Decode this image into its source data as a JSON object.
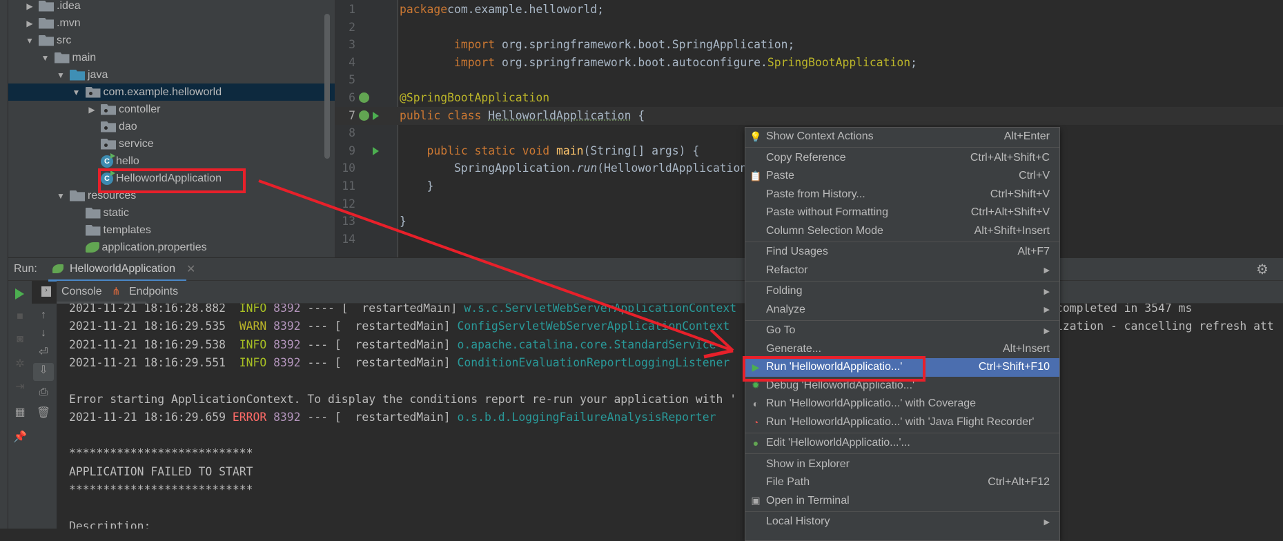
{
  "project_tree": [
    {
      "label": ".idea",
      "depth": 0,
      "arrow": "right",
      "icon": "folder"
    },
    {
      "label": ".mvn",
      "depth": 0,
      "arrow": "right",
      "icon": "folder"
    },
    {
      "label": "src",
      "depth": 0,
      "arrow": "down",
      "icon": "folder"
    },
    {
      "label": "main",
      "depth": 1,
      "arrow": "down",
      "icon": "folder"
    },
    {
      "label": "java",
      "depth": 2,
      "arrow": "down",
      "icon": "source-folder"
    },
    {
      "label": "com.example.helloworld",
      "depth": 3,
      "arrow": "down",
      "icon": "package",
      "selected": true
    },
    {
      "label": "contoller",
      "depth": 4,
      "arrow": "right",
      "icon": "package"
    },
    {
      "label": "dao",
      "depth": 4,
      "arrow": "",
      "icon": "package"
    },
    {
      "label": "service",
      "depth": 4,
      "arrow": "",
      "icon": "package"
    },
    {
      "label": "hello",
      "depth": 4,
      "arrow": "",
      "icon": "class"
    },
    {
      "label": "HelloworldApplication",
      "depth": 4,
      "arrow": "",
      "icon": "spring-boot-class",
      "highlighted": true
    },
    {
      "label": "resources",
      "depth": 2,
      "arrow": "down",
      "icon": "resources-folder"
    },
    {
      "label": "static",
      "depth": 3,
      "arrow": "",
      "icon": "folder"
    },
    {
      "label": "templates",
      "depth": 3,
      "arrow": "",
      "icon": "folder"
    },
    {
      "label": "application.properties",
      "depth": 3,
      "arrow": "",
      "icon": "spring-properties"
    }
  ],
  "editor": {
    "current_line": 7,
    "lines": [
      {
        "n": "1",
        "tokens": [
          [
            "kw",
            "package"
          ],
          [
            "",
            "com.example.helloworld;"
          ]
        ]
      },
      {
        "n": "2",
        "tokens": []
      },
      {
        "n": "3",
        "tokens": [
          [
            "",
            "        "
          ],
          [
            "kw",
            "import"
          ],
          [
            "",
            " org.springframework.boot.SpringApplication;"
          ]
        ]
      },
      {
        "n": "4",
        "tokens": [
          [
            "",
            "        "
          ],
          [
            "kw",
            "import"
          ],
          [
            "",
            " org.springframework.boot.autoconfigure."
          ],
          [
            "an",
            "SpringBootApplication"
          ],
          [
            "",
            ";"
          ]
        ]
      },
      {
        "n": "5",
        "tokens": []
      },
      {
        "n": "6",
        "tokens": [
          [
            "an",
            "@SpringBootApplication"
          ]
        ],
        "gutter": "spring"
      },
      {
        "n": "7",
        "tokens": [
          [
            "kw",
            "public class "
          ],
          [
            "ul",
            "HelloworldApplication"
          ],
          [
            "",
            " {"
          ]
        ],
        "gutter": "spring-run"
      },
      {
        "n": "8",
        "tokens": []
      },
      {
        "n": "9",
        "tokens": [
          [
            "",
            "    "
          ],
          [
            "kw",
            "public static void "
          ],
          [
            "fn",
            "main"
          ],
          [
            "",
            "(String[] args) {"
          ]
        ],
        "gutter": "run"
      },
      {
        "n": "10",
        "tokens": [
          [
            "",
            "        SpringApplication."
          ],
          [
            "it",
            "run"
          ],
          [
            "",
            "(HelloworldApplication"
          ]
        ]
      },
      {
        "n": "11",
        "tokens": [
          [
            "",
            "    }"
          ]
        ]
      },
      {
        "n": "12",
        "tokens": []
      },
      {
        "n": "13",
        "tokens": [
          [
            "",
            "}"
          ]
        ]
      },
      {
        "n": "14",
        "tokens": []
      }
    ]
  },
  "run_panel": {
    "label": "Run:",
    "tab": "HelloworldApplication",
    "subtabs": [
      "Console",
      "Endpoints"
    ],
    "console": [
      {
        "ts": "2021-11-21 18:16:28.882",
        "level": "INFO",
        "pid": "8392",
        "thread": "---- [  restartedMain]",
        "logger": "w.s.c.ServletWebServerApplicationContext",
        "tail": "completed in 3547 ms"
      },
      {
        "ts": "2021-11-21 18:16:29.535",
        "level": "WARN",
        "pid": "8392",
        "thread": "--- [  restartedMain]",
        "logger": "ConfigServletWebServerApplicationContext",
        "tail": "ization - cancelling refresh att"
      },
      {
        "ts": "2021-11-21 18:16:29.538",
        "level": "INFO",
        "pid": "8392",
        "thread": "--- [  restartedMain]",
        "logger": "o.apache.catalina.core.StandardService"
      },
      {
        "ts": "2021-11-21 18:16:29.551",
        "level": "INFO",
        "pid": "8392",
        "thread": "--- [  restartedMain]",
        "logger": "ConditionEvaluationReportLoggingListener"
      },
      {
        "text": ""
      },
      {
        "text": "Error starting ApplicationContext. To display the conditions report re-run your application with '"
      },
      {
        "ts": "2021-11-21 18:16:29.659",
        "level": "ERROR",
        "pid": "8392",
        "thread": "--- [  restartedMain]",
        "logger": "o.s.b.d.LoggingFailureAnalysisReporter"
      },
      {
        "text": ""
      },
      {
        "text": "***************************"
      },
      {
        "text": "APPLICATION FAILED TO START"
      },
      {
        "text": "***************************"
      },
      {
        "text": ""
      },
      {
        "text": "Description:"
      }
    ]
  },
  "context_menu": [
    {
      "label": "Show Context Actions",
      "shortcut": "Alt+Enter",
      "icon": "lightbulb"
    },
    {
      "sep": true
    },
    {
      "label": "Copy Reference",
      "shortcut": "Ctrl+Alt+Shift+C"
    },
    {
      "label": "Paste",
      "shortcut": "Ctrl+V",
      "icon": "clipboard"
    },
    {
      "label": "Paste from History...",
      "shortcut": "Ctrl+Shift+V"
    },
    {
      "label": "Paste without Formatting",
      "shortcut": "Ctrl+Alt+Shift+V"
    },
    {
      "label": "Column Selection Mode",
      "shortcut": "Alt+Shift+Insert"
    },
    {
      "sep": true
    },
    {
      "label": "Find Usages",
      "shortcut": "Alt+F7"
    },
    {
      "label": "Refactor",
      "submenu": true
    },
    {
      "sep": true
    },
    {
      "label": "Folding",
      "submenu": true
    },
    {
      "label": "Analyze",
      "submenu": true
    },
    {
      "sep": true
    },
    {
      "label": "Go To",
      "submenu": true
    },
    {
      "label": "Generate...",
      "shortcut": "Alt+Insert"
    },
    {
      "label": "Run 'HelloworldApplicatio...'",
      "shortcut": "Ctrl+Shift+F10",
      "icon": "run",
      "highlighted": true
    },
    {
      "label": "Debug 'HelloworldApplicatio...'",
      "icon": "debug"
    },
    {
      "label": "Run 'HelloworldApplicatio...' with Coverage",
      "icon": "coverage"
    },
    {
      "label": "Run 'HelloworldApplicatio...' with 'Java Flight Recorder'",
      "icon": "profiler"
    },
    {
      "sep": true
    },
    {
      "label": "Edit 'HelloworldApplicatio...'...",
      "icon": "spring-edit"
    },
    {
      "sep": true
    },
    {
      "label": "Show in Explorer"
    },
    {
      "label": "File Path",
      "shortcut": "Ctrl+Alt+F12"
    },
    {
      "label": "Open in Terminal",
      "icon": "terminal"
    },
    {
      "sep": true
    },
    {
      "label": "Local History",
      "submenu": true
    }
  ],
  "colors": {
    "annotation_red": "#e8202a",
    "menu_highlight": "#4b6eaf",
    "tree_selection": "#0d293e"
  }
}
